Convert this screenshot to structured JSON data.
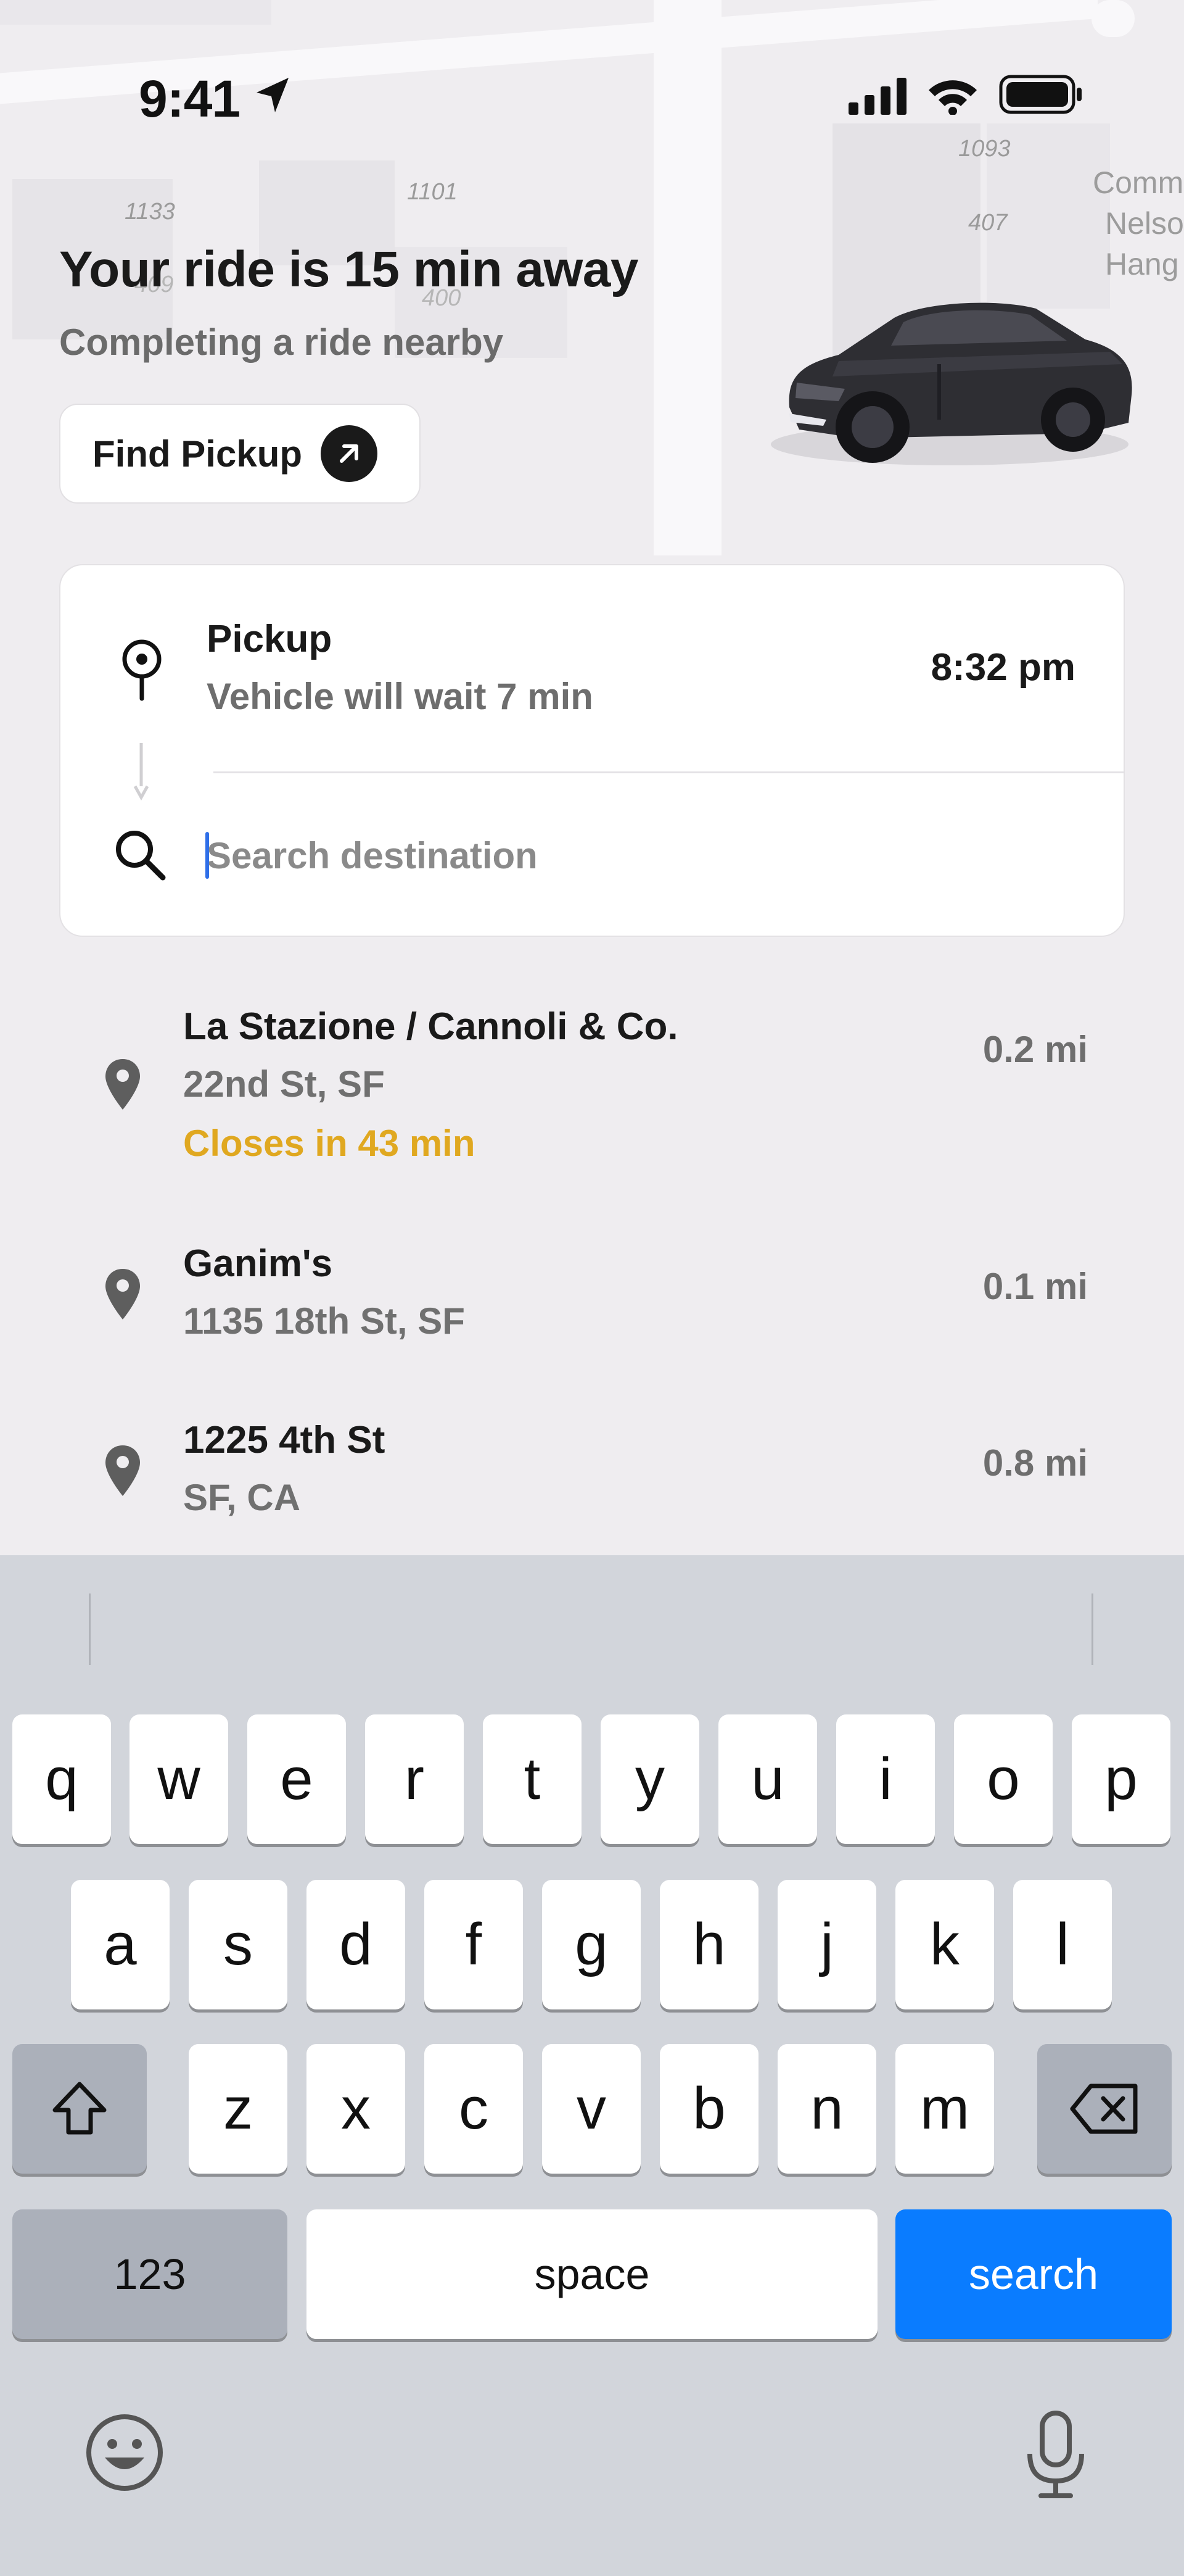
{
  "status_bar": {
    "time": "9:41"
  },
  "map": {
    "labels": [
      "1133",
      "1101",
      "409",
      "400",
      "1093",
      "407"
    ],
    "place_lines": [
      "Comm",
      "Nelso",
      "Hang"
    ]
  },
  "header": {
    "title": "Your ride is 15 min away",
    "subtitle": "Completing a ride nearby",
    "find_pickup_label": "Find Pickup"
  },
  "trip": {
    "pickup_title": "Pickup",
    "pickup_subtitle": "Vehicle will wait 7 min",
    "pickup_time": "8:32 pm",
    "search_placeholder": "Search destination",
    "search_value": ""
  },
  "results": [
    {
      "name": "La Stazione / Cannoli & Co.",
      "address": "22nd St, SF",
      "note": "Closes in 43 min",
      "distance": "0.2 mi"
    },
    {
      "name": "Ganim's",
      "address": "1135 18th St, SF",
      "distance": "0.1 mi"
    },
    {
      "name": "1225 4th St",
      "address": "SF, CA",
      "distance": "0.8 mi"
    }
  ],
  "keyboard": {
    "row1": [
      "q",
      "w",
      "e",
      "r",
      "t",
      "y",
      "u",
      "i",
      "o",
      "p"
    ],
    "row2": [
      "a",
      "s",
      "d",
      "f",
      "g",
      "h",
      "j",
      "k",
      "l"
    ],
    "row3": [
      "z",
      "x",
      "c",
      "v",
      "b",
      "n",
      "m"
    ],
    "numbers_label": "123",
    "space_label": "space",
    "search_label": "search"
  },
  "colors": {
    "accent_blue": "#0a7cff",
    "warning_yellow": "#e0a820",
    "caret_blue": "#2f6fe8"
  },
  "icons": {
    "location": "location-arrow-icon",
    "signal": "cellular-signal-icon",
    "wifi": "wifi-icon",
    "battery": "battery-icon",
    "arrow": "arrow-up-right-icon",
    "pickup": "pickup-pin-icon",
    "search": "search-icon",
    "place": "map-pin-icon",
    "shift": "shift-icon",
    "delete": "delete-icon",
    "emoji": "emoji-icon",
    "mic": "microphone-icon"
  }
}
